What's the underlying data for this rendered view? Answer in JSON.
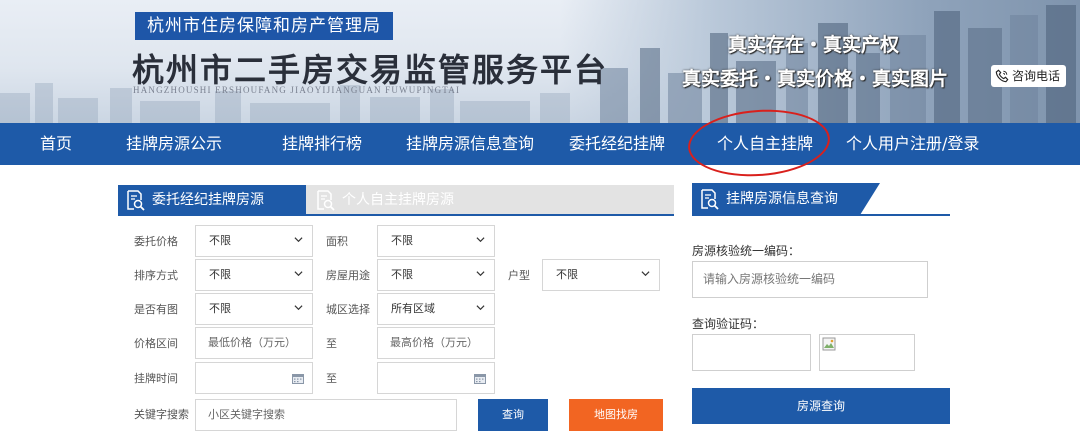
{
  "header": {
    "agency": "杭州市住房保障和房产管理局",
    "title": "杭州市二手房交易监管服务平台",
    "pinyin": "HANGZHOUSHI  ERSHOUFANG  JIAOYIJIANGUAN  FUWUPINGTAI",
    "slogan_line1": "真实存在・真实产权",
    "slogan_line2": "真实委托・真实价格・真实图片",
    "consult": "咨询电话"
  },
  "nav": {
    "items": [
      "首页",
      "挂牌房源公示",
      "挂牌排行榜",
      "挂牌房源信息查询",
      "委托经纪挂牌",
      "个人自主挂牌",
      "个人用户注册/登录"
    ]
  },
  "listing": {
    "tab_active": "委托经纪挂牌房源",
    "tab_inactive": "个人自主挂牌房源",
    "labels": {
      "price": "委托价格",
      "area": "面积",
      "sort": "排序方式",
      "usage": "房屋用途",
      "layout": "户型",
      "has_image": "是否有图",
      "district": "城区选择",
      "price_range": "价格区间",
      "to1": "至",
      "list_time": "挂牌时间",
      "to2": "至",
      "keyword": "关键字搜索"
    },
    "values": {
      "price": "不限",
      "area": "不限",
      "sort": "不限",
      "usage": "不限",
      "layout": "不限",
      "has_image": "不限",
      "district": "所有区域"
    },
    "placeholders": {
      "min_price": "最低价格（万元）",
      "max_price": "最高价格（万元）",
      "keyword": "小区关键字搜索"
    },
    "buttons": {
      "search": "查询",
      "map": "地图找房"
    }
  },
  "query_panel": {
    "title": "挂牌房源信息查询",
    "code_label": "房源核验统一编码：",
    "code_placeholder": "请输入房源核验统一编码",
    "captcha_label": "查询验证码：",
    "submit": "房源查询"
  },
  "colors": {
    "primary": "#1e5aa8",
    "accent_orange": "#f26522",
    "highlight_circle": "#d9201c"
  }
}
